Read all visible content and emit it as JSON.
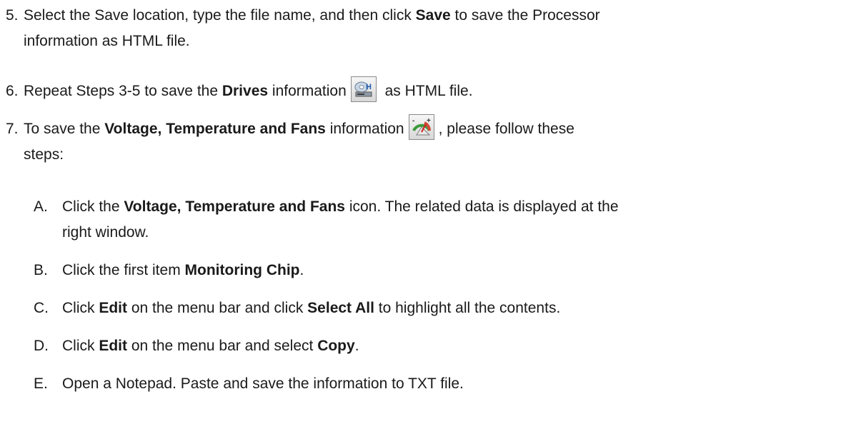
{
  "steps": [
    {
      "num": "5.",
      "line1": [
        "Select the Save location, type the file name, and then click ",
        "Save",
        " to save the Processor"
      ],
      "line2": "information as HTML file."
    },
    {
      "num": "6.",
      "line1": [
        "Repeat Steps 3-5 to save the ",
        "Drives",
        " information",
        " as HTML file."
      ],
      "icon": "drives-icon"
    },
    {
      "num": "7.",
      "line1": [
        "To save the ",
        "Voltage, Temperature and Fans",
        " information",
        ", please follow these"
      ],
      "line2": "steps:",
      "icon": "voltage-gauge-icon"
    }
  ],
  "substeps": [
    {
      "letter": "A.",
      "line1": [
        "Click the ",
        "Voltage, Temperature and Fans",
        " icon. The related data is displayed at the"
      ],
      "line2": "right window."
    },
    {
      "letter": "B.",
      "line1": [
        "Click the first item ",
        "Monitoring Chip",
        "."
      ]
    },
    {
      "letter": "C.",
      "line1": [
        "Click ",
        "Edit",
        " on the menu bar and click ",
        "Select All",
        " to highlight all the contents."
      ]
    },
    {
      "letter": "D.",
      "line1": [
        "Click ",
        "Edit",
        " on the menu bar and select ",
        "Copy",
        "."
      ]
    },
    {
      "letter": "E.",
      "line1": [
        "Open a Notepad. Paste and save the information to TXT file."
      ]
    }
  ]
}
